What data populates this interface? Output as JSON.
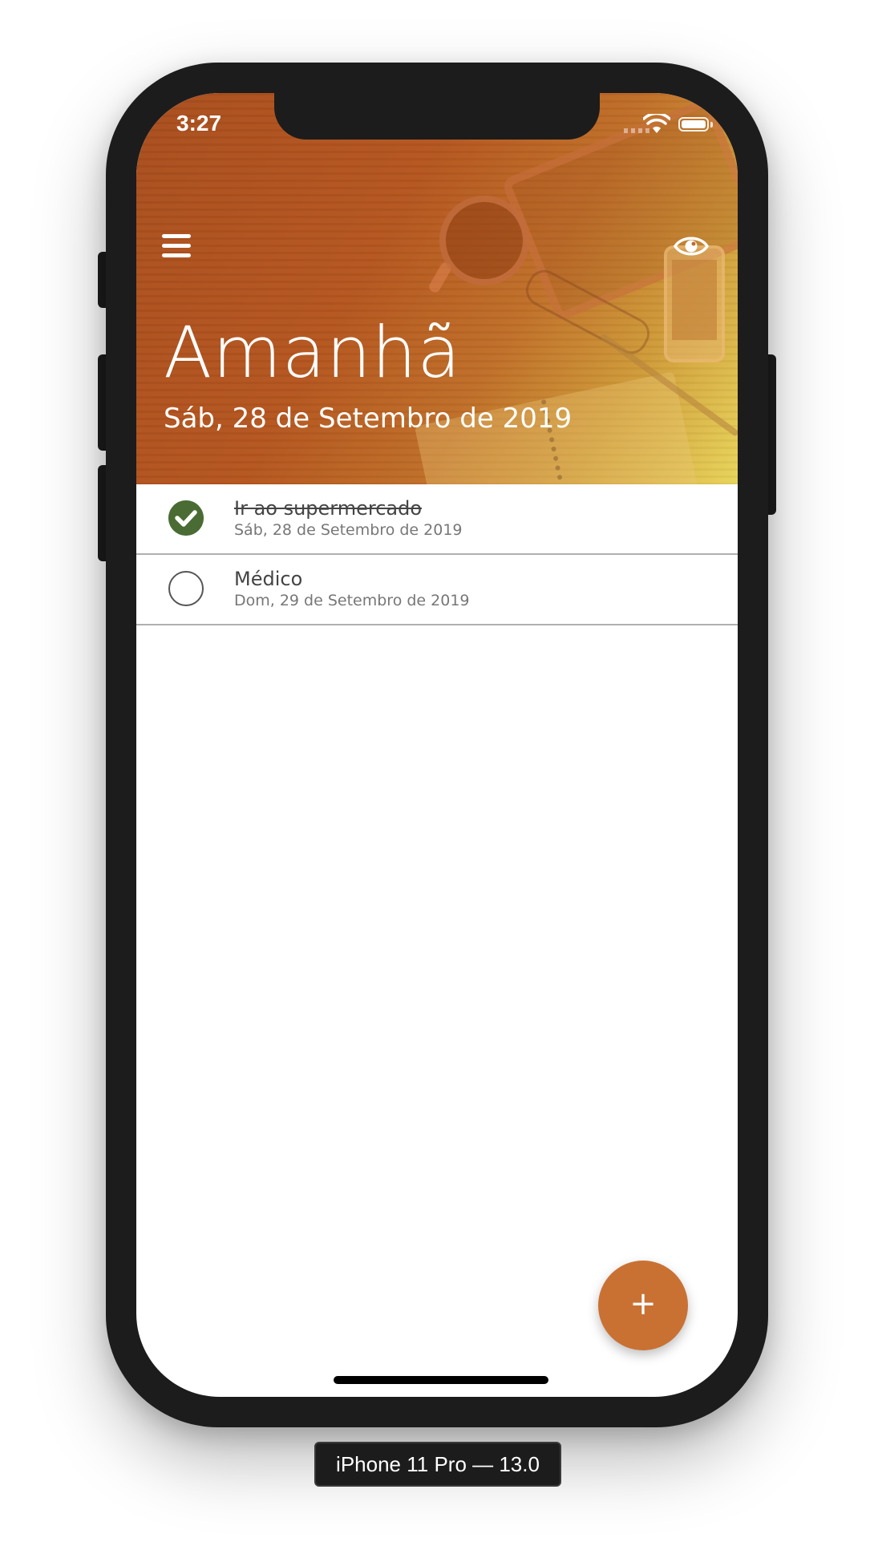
{
  "status_bar": {
    "time": "3:27"
  },
  "header": {
    "title": "Amanhã",
    "date": "Sáb, 28 de Setembro de 2019",
    "menu_icon": "hamburger-menu-icon",
    "visibility_icon": "eye-icon"
  },
  "tasks": [
    {
      "title": "Ir ao supermercado",
      "date": "Sáb, 28 de Setembro de 2019",
      "completed": true
    },
    {
      "title": "Médico",
      "date": "Dom, 29 de Setembro de 2019",
      "completed": false
    }
  ],
  "fab": {
    "label": "+"
  },
  "simulator": {
    "device_label": "iPhone 11 Pro — 13.0"
  },
  "colors": {
    "accent": "#c97133",
    "done_check": "#4a6b33",
    "device_frame": "#1c1c1c"
  }
}
